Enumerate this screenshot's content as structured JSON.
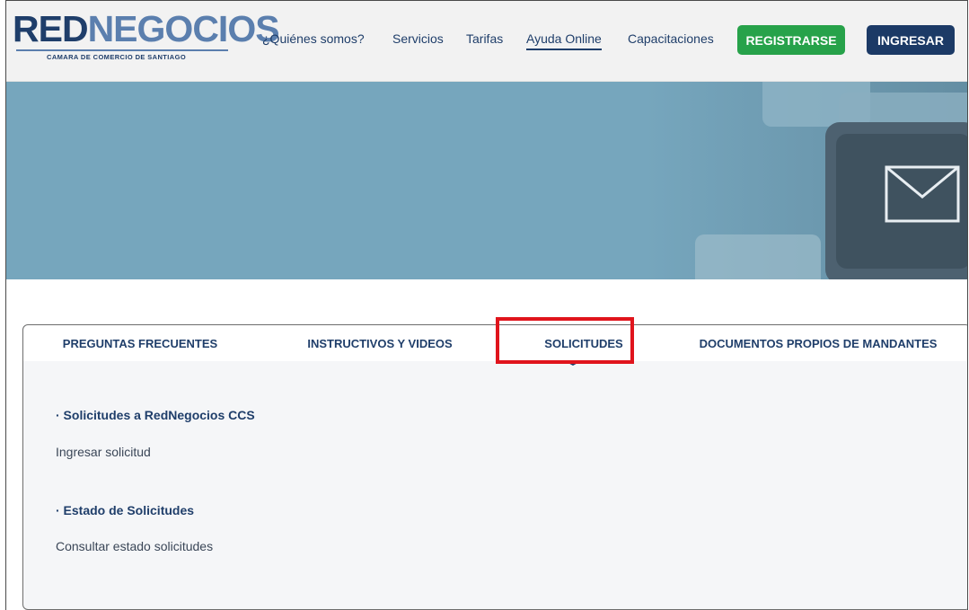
{
  "logo": {
    "main_red": "RED",
    "main_neg": "NEGOCIOS",
    "subtitle": "CAMARA DE COMERCIO DE SANTIAGO"
  },
  "nav": {
    "items": [
      "¿Quiénes somos?",
      "Servicios",
      "Tarifas",
      "Ayuda Online",
      "Capacitaciones"
    ],
    "active": "Ayuda Online"
  },
  "buttons": {
    "register": "REGISTRARSE",
    "login": "INGRESAR"
  },
  "tabs": [
    "PREGUNTAS FRECUENTES",
    "INSTRUCTIVOS Y VIDEOS",
    "SOLICITUDES",
    "DOCUMENTOS PROPIOS DE MANDANTES"
  ],
  "active_tab": "SOLICITUDES",
  "content": {
    "section1_title": "· Solicitudes a RedNegocios CCS",
    "section1_link": "Ingresar solicitud",
    "section2_title": "· Estado de Solicitudes",
    "section2_link": "Consultar estado solicitudes"
  },
  "colors": {
    "brand_navy": "#1f3e6a",
    "register_green": "#27a24a",
    "login_navy": "#1c3a66",
    "hero_blue": "#76a6bd",
    "highlight_red": "#e0141c"
  }
}
